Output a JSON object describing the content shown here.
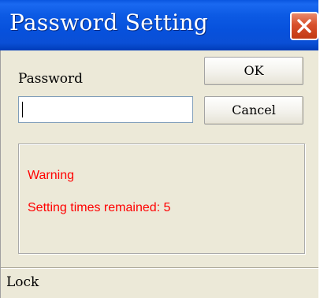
{
  "window": {
    "title": "Password Setting"
  },
  "form": {
    "password_label": "Password",
    "password_value": ""
  },
  "buttons": {
    "ok_label": "OK",
    "cancel_label": "Cancel"
  },
  "warning": {
    "title": "Warning",
    "remaining_text": "Setting times remained: 5"
  },
  "status_bar": {
    "text": "Lock"
  },
  "icons": {
    "close": "close-icon"
  },
  "colors": {
    "titlebar": "#0a54dc",
    "close_button": "#d8502b",
    "warning_text": "#ff0000",
    "dialog_bg": "#ece9d8"
  }
}
